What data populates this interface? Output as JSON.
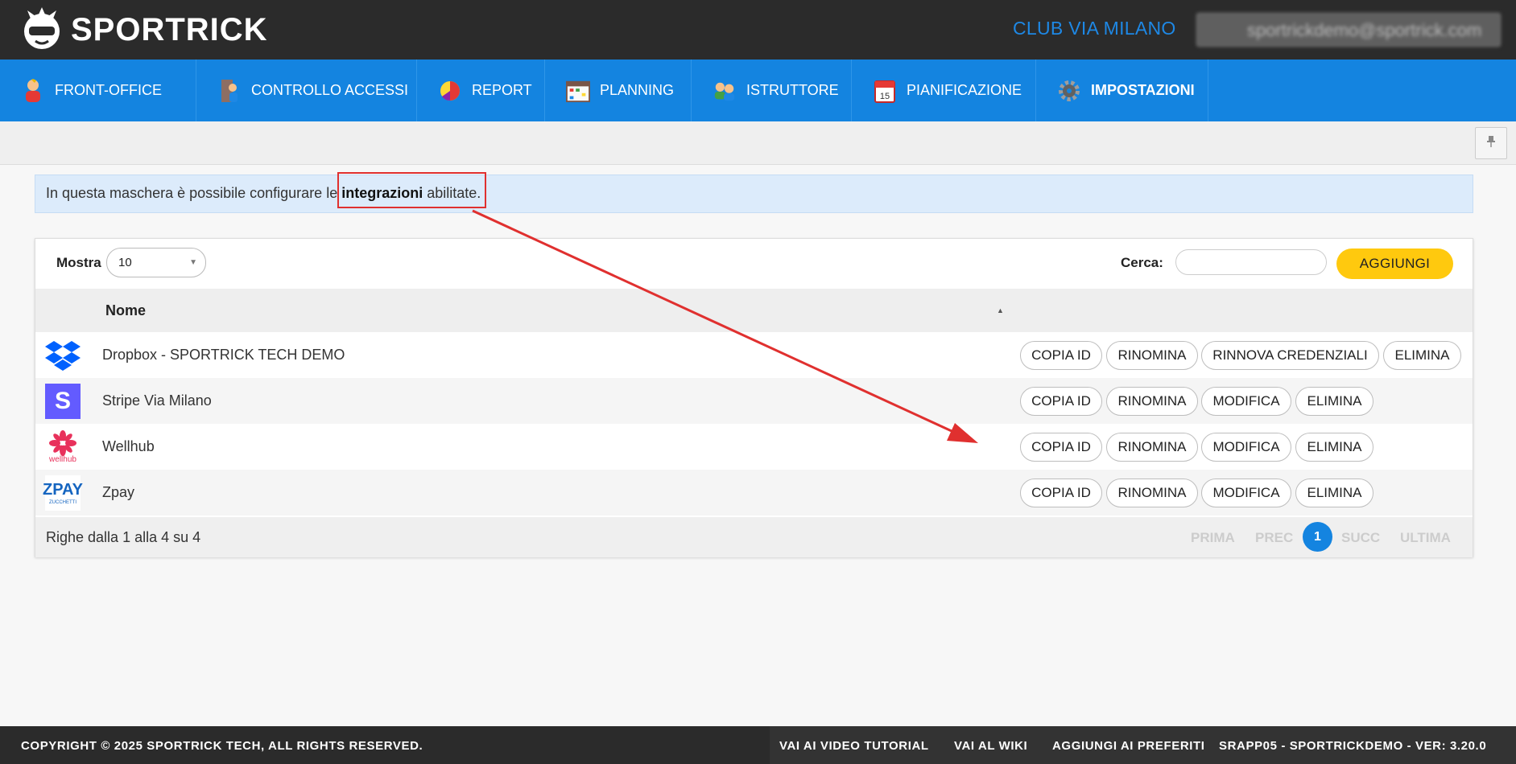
{
  "header": {
    "brand": "SPORTRICK",
    "club": "CLUB VIA MILANO",
    "user": "sportrickdemo@sportrick.com"
  },
  "nav": {
    "items": [
      {
        "label": "FRONT-OFFICE",
        "icon": "person-icon"
      },
      {
        "label": "CONTROLLO ACCESSI",
        "icon": "access-control-icon"
      },
      {
        "label": "REPORT",
        "icon": "pie-chart-icon"
      },
      {
        "label": "PLANNING",
        "icon": "calendar-grid-icon"
      },
      {
        "label": "ISTRUTTORE",
        "icon": "group-icon"
      },
      {
        "label": "PIANIFICAZIONE",
        "icon": "calendar-icon"
      },
      {
        "label": "IMPOSTAZIONI",
        "icon": "gear-icon"
      }
    ],
    "active": "IMPOSTAZIONI"
  },
  "info": {
    "prefix": "In questa maschera è possibile configurare le ",
    "bold": "integrazioni",
    "suffix": " abilitate."
  },
  "table": {
    "show_label": "Mostra",
    "show_value": "10",
    "search_label": "Cerca:",
    "search_value": "",
    "add_label": "AGGIUNGI",
    "column_name": "Nome",
    "rows": [
      {
        "name": "Dropbox - SPORTRICK TECH DEMO",
        "logo": "dropbox-icon",
        "actions": [
          "COPIA ID",
          "RINOMINA",
          "RINNOVA CREDENZIALI",
          "ELIMINA"
        ]
      },
      {
        "name": "Stripe Via Milano",
        "logo": "stripe-icon",
        "actions": [
          "COPIA ID",
          "RINOMINA",
          "MODIFICA",
          "ELIMINA"
        ]
      },
      {
        "name": "Wellhub",
        "logo": "wellhub-icon",
        "actions": [
          "COPIA ID",
          "RINOMINA",
          "MODIFICA",
          "ELIMINA"
        ]
      },
      {
        "name": "Zpay",
        "logo": "zpay-icon",
        "actions": [
          "COPIA ID",
          "RINOMINA",
          "MODIFICA",
          "ELIMINA"
        ]
      }
    ],
    "footer_count": "Righe dalla 1 alla 4 su 4",
    "pager": {
      "first": "PRIMA",
      "prev": "PREC",
      "current": "1",
      "next": "SUCC",
      "last": "ULTIMA"
    }
  },
  "logos": {
    "stripe_letter": "S",
    "wellhub_word": "wellhub",
    "zpay_word": "ZPAY",
    "zpay_sub": "ZUCCHETTI"
  },
  "footer": {
    "copyright": "COPYRIGHT © 2025 SPORTRICK TECH, ALL RIGHTS RESERVED.",
    "video": "VAI AI VIDEO TUTORIAL",
    "wiki": "VAI AL WIKI",
    "favorites": "AGGIUNGI AI PREFERITI",
    "version": "SRAPP05 - SPORTRICKDEMO - VER: 3.20.0"
  },
  "colors": {
    "nav_blue": "#1484e0",
    "header_dark": "#2b2b2b",
    "add_yellow": "#ffc90e",
    "annotation_red": "#e0302f"
  }
}
